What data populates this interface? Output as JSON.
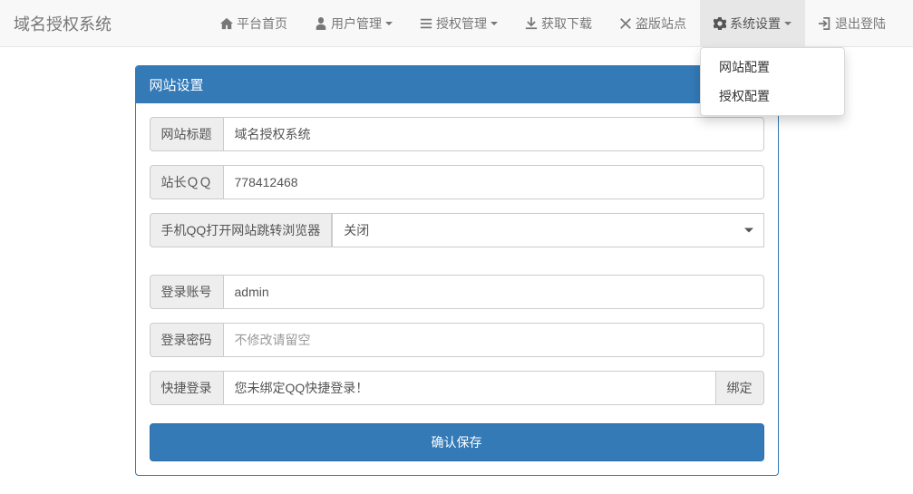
{
  "brand": "域名授权系统",
  "nav": {
    "home": "平台首页",
    "users": "用户管理",
    "auth": "授权管理",
    "download": "获取下载",
    "piracy": "盗版站点",
    "settings": "系统设置",
    "logout": "退出登陆"
  },
  "dropdown": {
    "site_config": "网站配置",
    "auth_config": "授权配置"
  },
  "panel": {
    "title": "网站设置"
  },
  "form": {
    "site_title_label": "网站标题",
    "site_title_value": "域名授权系统",
    "qq_label": "站长ＱＱ",
    "qq_value": "778412468",
    "mobile_qq_label": "手机QQ打开网站跳转浏览器",
    "mobile_qq_value": "关闭",
    "login_user_label": "登录账号",
    "login_user_value": "admin",
    "login_pass_label": "登录密码",
    "login_pass_placeholder": "不修改请留空",
    "quick_login_label": "快捷登录",
    "quick_login_value": "您未绑定QQ快捷登录！",
    "bind_label": "绑定",
    "submit_label": "确认保存"
  }
}
